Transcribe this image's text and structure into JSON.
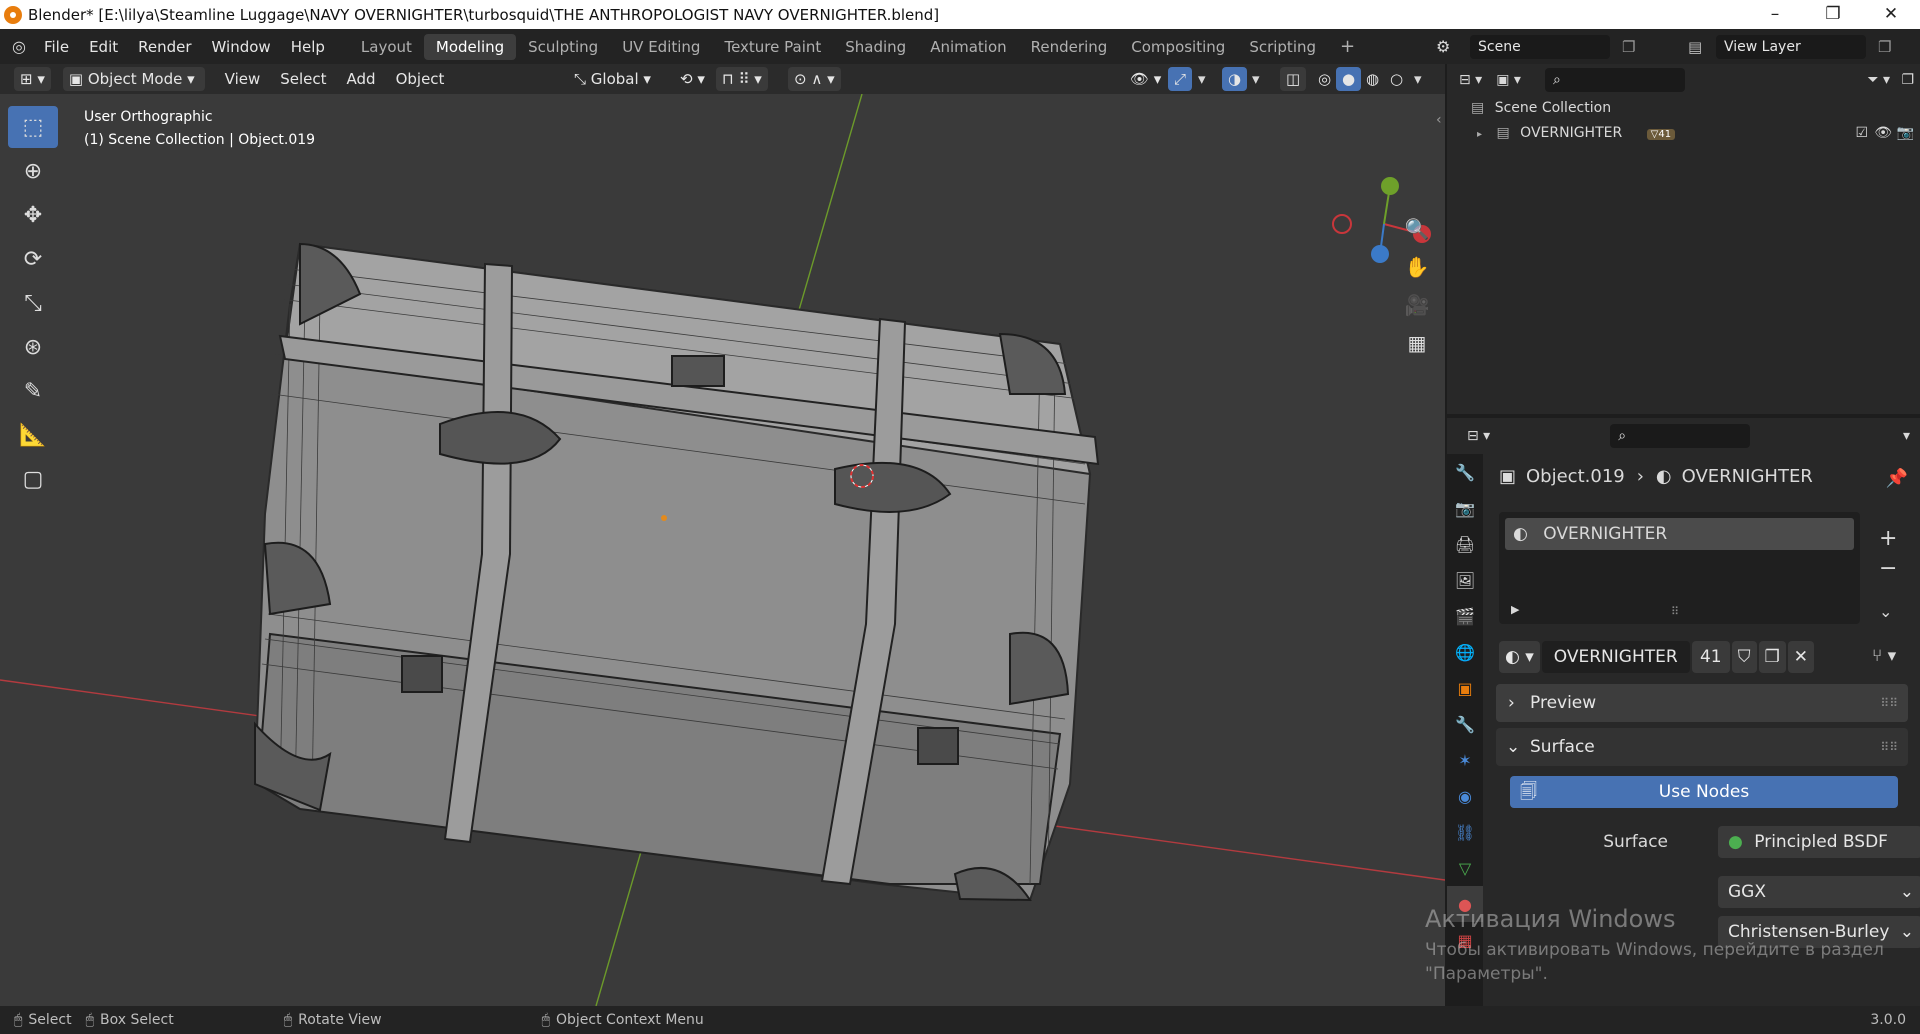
{
  "window": {
    "title": "Blender* [E:\\lilya\\Steamline Luggage\\NAVY OVERNIGHTER\\turbosquid\\THE ANTHROPOLOGIST NAVY OVERNIGHTER.blend]",
    "minimize": "–",
    "maximize": "❐",
    "close": "✕"
  },
  "menu": [
    "File",
    "Edit",
    "Render",
    "Window",
    "Help"
  ],
  "workspaces": [
    "Layout",
    "Modeling",
    "Sculpting",
    "UV Editing",
    "Texture Paint",
    "Shading",
    "Animation",
    "Rendering",
    "Compositing",
    "Scripting"
  ],
  "add_workspace": "+",
  "scene": {
    "label": "Scene",
    "view_layer": "View Layer"
  },
  "viewport_header": {
    "mode": "Object Mode",
    "view": "View",
    "select": "Select",
    "add": "Add",
    "object": "Object",
    "orientation": "Global"
  },
  "viewport": {
    "view_name": "User Orthographic",
    "collection_info": "(1) Scene Collection | Object.019"
  },
  "outliner": {
    "root": "Scene Collection",
    "items": [
      {
        "name": "OVERNIGHTER",
        "badge": "41"
      }
    ]
  },
  "properties": {
    "object_name": "Object.019",
    "material_name": "OVERNIGHTER",
    "slot": "OVERNIGHTER",
    "datablock_name": "OVERNIGHTER",
    "users": "41",
    "panels": {
      "preview": "Preview",
      "surface": "Surface"
    },
    "use_nodes": "Use Nodes",
    "surface_label": "Surface",
    "surface_value": "Principled BSDF",
    "distribution": "GGX",
    "subsurface": "Christensen-Burley"
  },
  "status": {
    "select": "Select",
    "box_select": "Box Select",
    "rotate": "Rotate View",
    "context": "Object Context Menu",
    "version": "3.0.0"
  },
  "activation": {
    "title": "Активация Windows",
    "line1": "Чтобы активировать Windows, перейдите в раздел",
    "line2": "\"Параметры\"."
  },
  "colors": {
    "accent": "#4772b3",
    "x_axis": "#c8363b",
    "y_axis": "#6ea02a",
    "z_axis": "#3b7ac8"
  }
}
